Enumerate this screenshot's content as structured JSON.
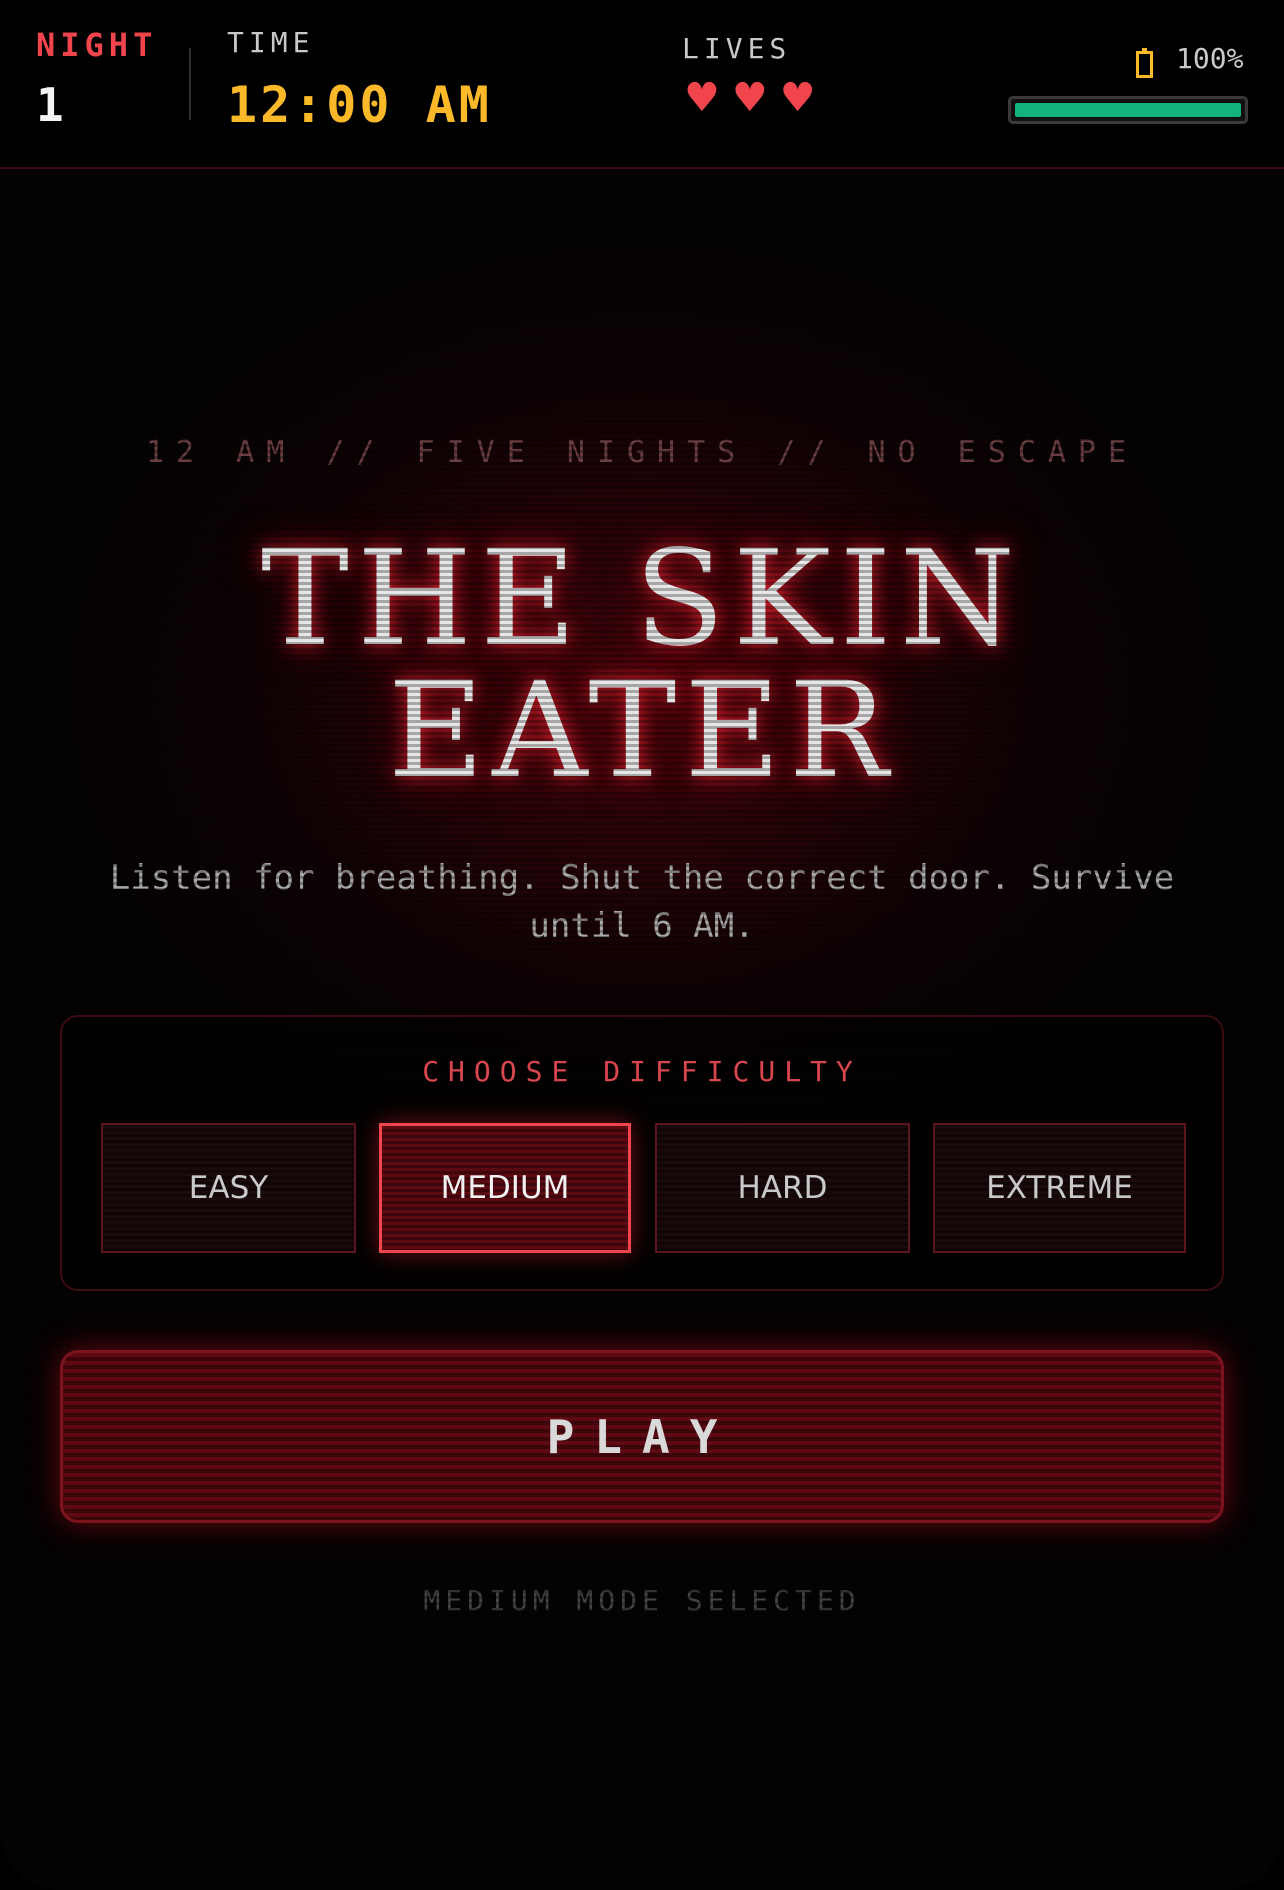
{
  "hud": {
    "night_label": "NIGHT",
    "night_value": "1",
    "time_label": "TIME",
    "time_value": "12:00 AM",
    "lives_label": "LIVES",
    "lives_count": 3,
    "heart_icon": "heart-icon",
    "battery_icon": "battery-icon",
    "battery_percent": "100%",
    "battery_level": 1.0,
    "battery_color": "#12b37d"
  },
  "intro": {
    "tagline": "12 AM // FIVE NIGHTS // NO ESCAPE",
    "title_line1": "THE SKIN",
    "title_line2": "EATER",
    "subtitle": "Listen for breathing. Shut the correct door. Survive until 6 AM."
  },
  "difficulty": {
    "heading": "CHOOSE DIFFICULTY",
    "options": [
      "EASY",
      "MEDIUM",
      "HARD",
      "EXTREME"
    ],
    "selected": "MEDIUM"
  },
  "play_label": "PLAY",
  "status_text": "MEDIUM MODE SELECTED",
  "colors": {
    "accent_red": "#f0454c",
    "time_yellow": "#fbb829",
    "battery_green": "#12b37d"
  }
}
